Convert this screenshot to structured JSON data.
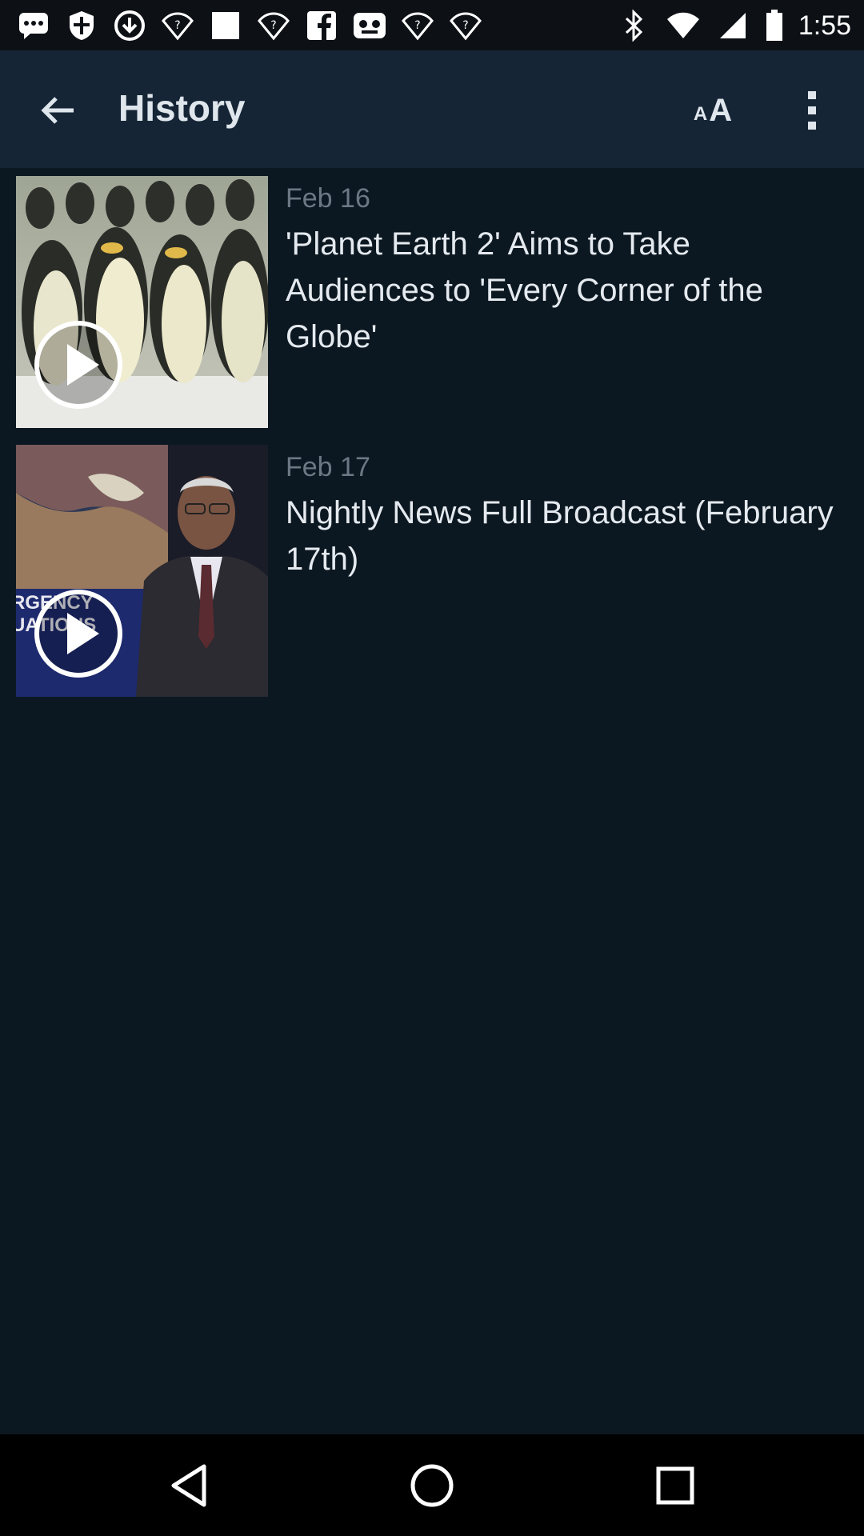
{
  "status_bar": {
    "time": "1:55",
    "left_icons": [
      "chat-bubble-icon",
      "shield-icon",
      "download-icon",
      "wifi-question-icon",
      "square-icon",
      "wifi-question-icon",
      "facebook-icon",
      "voicemail-icon",
      "wifi-question-icon",
      "wifi-question-icon"
    ],
    "right_icons": [
      "bluetooth-icon",
      "wifi-icon",
      "signal-icon",
      "battery-icon"
    ]
  },
  "app_bar": {
    "title": "History",
    "text_size_small": "A",
    "text_size_large": "A"
  },
  "items": [
    {
      "date": "Feb 16",
      "title": "'Planet Earth 2' Aims to Take Audiences to 'Every Corner of the Globe'",
      "thumbnail": "penguins-image"
    },
    {
      "date": "Feb 17",
      "title": "Nightly News Full Broadcast (February 17th)",
      "thumbnail": "news-anchor-image",
      "thumbnail_text": "RGENCY\nUATIONS"
    }
  ],
  "nav_bar": {
    "icons": [
      "back-triangle-icon",
      "home-circle-icon",
      "recents-square-icon"
    ]
  },
  "colors": {
    "background": "#0c1821",
    "app_bar": "#152536",
    "title_text": "#e4eaef",
    "date_text": "#6b7985"
  }
}
